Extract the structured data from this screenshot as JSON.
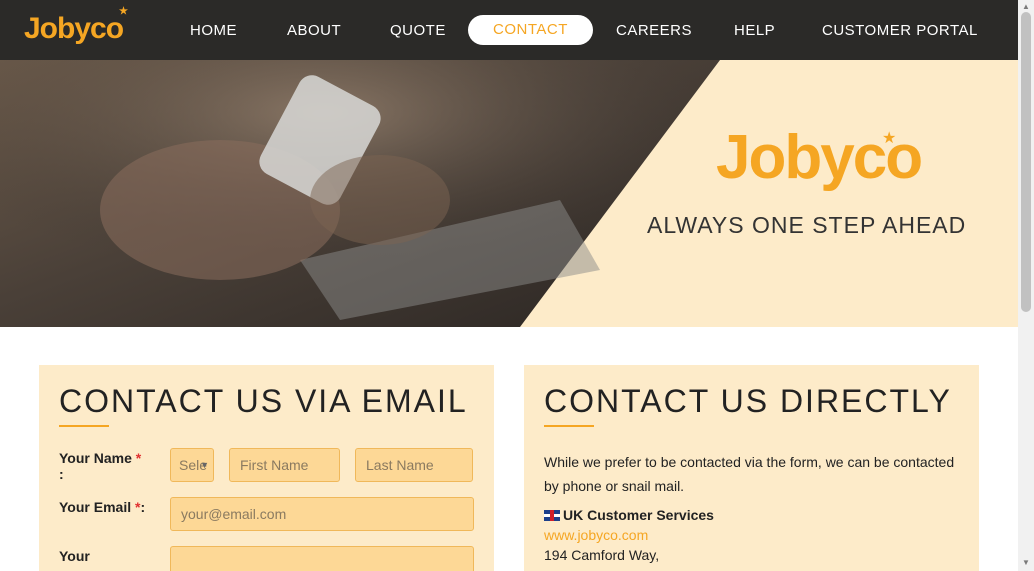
{
  "nav": {
    "logo": "Jobyco",
    "items": [
      {
        "label": "HOME"
      },
      {
        "label": "ABOUT"
      },
      {
        "label": "QUOTE"
      },
      {
        "label": "CONTACT"
      },
      {
        "label": "CAREERS"
      },
      {
        "label": "HELP"
      },
      {
        "label": "CUSTOMER PORTAL"
      }
    ],
    "active": "CONTACT"
  },
  "hero": {
    "logo": "Jobyco",
    "tagline": "ALWAYS ONE STEP AHEAD"
  },
  "email_panel": {
    "title": "CONTACT US VIA EMAIL",
    "name_label": "Your Name",
    "name_req": "*",
    "name_colon": ":",
    "title_select_value": "Sele",
    "first_name_placeholder": "First Name",
    "last_name_placeholder": "Last Name",
    "email_label": "Your Email",
    "email_req": "*",
    "email_colon": ":",
    "email_placeholder": "your@email.com",
    "third_label": "Your"
  },
  "direct_panel": {
    "title": "CONTACT US DIRECTLY",
    "intro": "While we prefer to be contacted via the form, we can be contacted by phone or snail mail.",
    "uk_heading": "UK Customer Services",
    "website": "www.jobyco.com",
    "address_line1": "194 Camford Way,"
  },
  "colors": {
    "accent": "#f5a623",
    "nav_bg": "#2b2a28",
    "panel_bg": "#fdebc9",
    "field_bg": "#fdd896"
  },
  "icons": [
    "star-icon",
    "uk-flag-icon",
    "chevron-down-icon"
  ]
}
